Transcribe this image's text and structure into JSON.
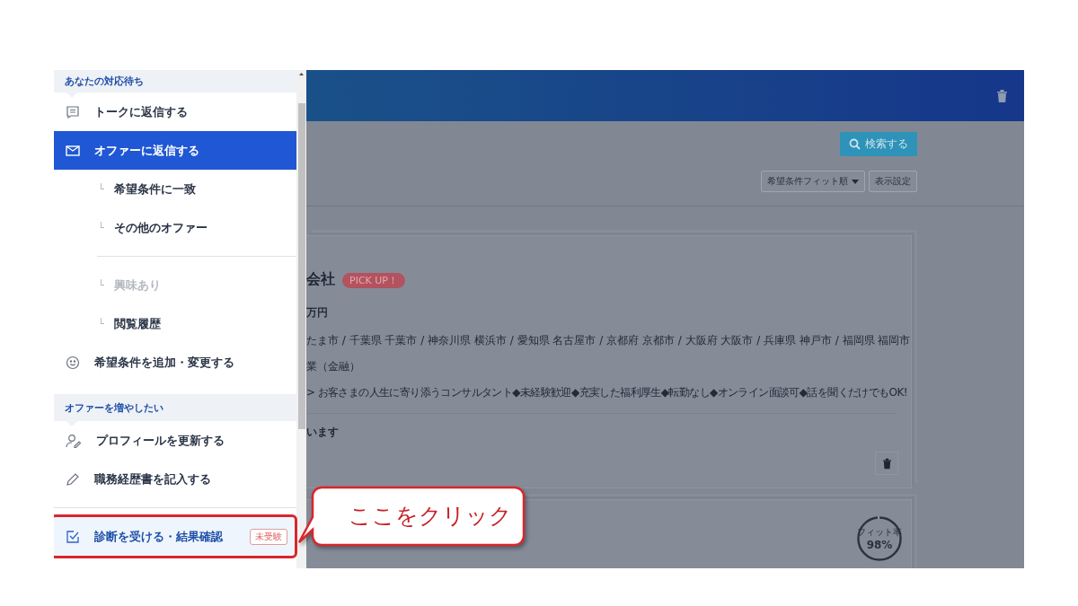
{
  "sidebar": {
    "sections": [
      {
        "title": "あなたの対応待ち",
        "items": [
          {
            "label": "トークに返信する",
            "selected": false
          },
          {
            "label": "オファーに返信する",
            "selected": true,
            "children": [
              {
                "marker": "└",
                "label": "希望条件に一致",
                "disabled": false,
                "divider_before": false
              },
              {
                "marker": "└",
                "label": "その他のオファー",
                "disabled": false,
                "divider_before": false
              },
              {
                "marker": "└",
                "label": "興味あり",
                "disabled": true,
                "divider_before": true
              },
              {
                "marker": "└",
                "label": "閲覧履歴",
                "disabled": false,
                "divider_before": false
              }
            ]
          },
          {
            "label": "希望条件を追加・変更する",
            "selected": false
          }
        ]
      },
      {
        "title": "オファーを増やしたい",
        "items": [
          {
            "label": "プロフィールを更新する",
            "selected": false
          },
          {
            "label": "職務経歴書を記入する",
            "selected": false
          },
          {
            "label": "診断を受ける・結果確認",
            "selected": false,
            "badge": "未受験",
            "outlined": true,
            "divider_before": true
          }
        ]
      }
    ]
  },
  "toolbar": {
    "search_button": "検索する",
    "sort": "希望条件フィット順",
    "view_settings": "表示設定"
  },
  "cards": [
    {
      "company": "会社",
      "badge": "PICK UP！",
      "salary": "万円",
      "locations": "たま市 / 千葉県 千葉市 / 神奈川県 横浜市 / 愛知県 名古屋市 / 京都府 京都市 / 大阪府 大阪市 / 兵庫県 神戸市 / 福岡県 福岡市",
      "job": "業（金融）",
      "catch": "> お客さまの人生に寄り添うコンサルタント◆未経験歓迎◆充実した福利厚生◆転勤なし◆オンライン面談可◆話を聞くだけでもOK!",
      "note": "います"
    },
    {
      "fit_label": "フィット率",
      "fit": "98%",
      "level": 0.98
    }
  ],
  "callout": "ここをクリック"
}
